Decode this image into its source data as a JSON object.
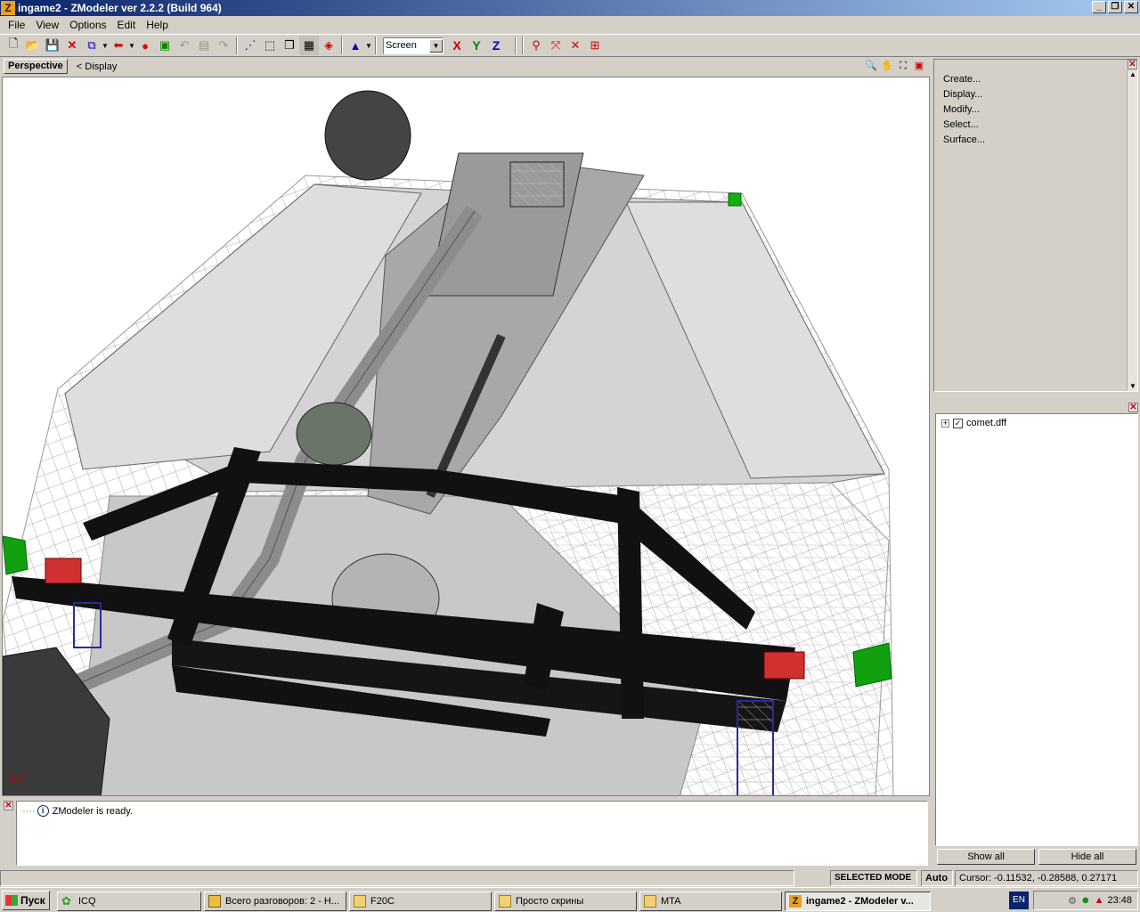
{
  "window": {
    "title": "ingame2 - ZModeler ver 2.2.2 (Build 964)"
  },
  "menu": {
    "items": [
      "File",
      "View",
      "Options",
      "Edit",
      "Help"
    ]
  },
  "toolbar": {
    "coord_mode": "Screen",
    "axis_x": "X",
    "axis_y": "Y",
    "axis_z": "Z",
    "colors": {
      "x": "#c00000",
      "y": "#008000",
      "z": "#0000c0"
    }
  },
  "viewport": {
    "tab": "Perspective",
    "display": "<  Display"
  },
  "right_panel": {
    "items": [
      "Create...",
      "Display...",
      "Modify...",
      "Select...",
      "Surface..."
    ]
  },
  "tree": {
    "root": "comet.dff",
    "checked": true
  },
  "buttons": {
    "show_all": "Show all",
    "hide_all": "Hide all"
  },
  "console": {
    "message": "ZModeler is ready."
  },
  "status": {
    "mode": "SELECTED MODE",
    "auto": "Auto",
    "cursor": "Cursor: -0.11532, -0.28588, 0.27171"
  },
  "taskbar": {
    "start": "Пуск",
    "tasks": [
      {
        "label": "ICQ",
        "icon": "icq-icon"
      },
      {
        "label": "Всего разговоров: 2 - Н...",
        "icon": "chat-icon"
      },
      {
        "label": "F20C",
        "icon": "folder-icon"
      },
      {
        "label": "Просто скрины",
        "icon": "folder-icon"
      },
      {
        "label": "MTA",
        "icon": "folder-icon"
      },
      {
        "label": "ingame2 - ZModeler v...",
        "icon": "zmodeler-icon"
      }
    ],
    "lang": "EN",
    "clock": "23:48"
  }
}
